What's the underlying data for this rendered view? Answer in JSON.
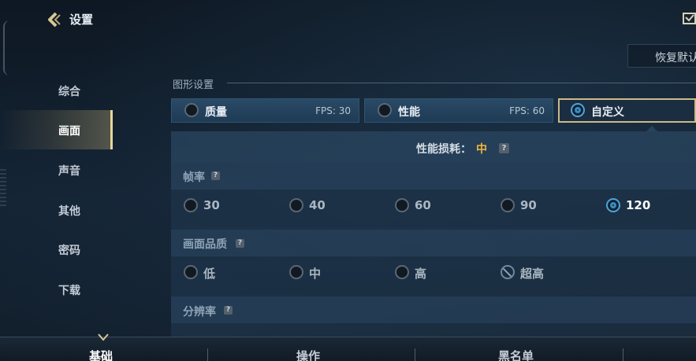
{
  "header": {
    "title": "设置",
    "restore_label": "恢复默认"
  },
  "sidebar": {
    "items": [
      {
        "label": "综合"
      },
      {
        "label": "画面",
        "active": true
      },
      {
        "label": "声音"
      },
      {
        "label": "其他"
      },
      {
        "label": "密码"
      },
      {
        "label": "下载"
      }
    ]
  },
  "graphics": {
    "section_title": "图形设置",
    "presets": [
      {
        "label": "质量",
        "fps": "FPS: 30"
      },
      {
        "label": "性能",
        "fps": "FPS: 60"
      },
      {
        "label": "自定义",
        "selected": true
      }
    ],
    "perf_label": "性能损耗：",
    "perf_value": "中",
    "help_glyph": "?",
    "framerate": {
      "title": "帧率",
      "options": [
        "30",
        "40",
        "60",
        "90",
        "120"
      ],
      "selected": "120"
    },
    "quality": {
      "title": "画面品质",
      "options": [
        "低",
        "中",
        "高",
        "超高"
      ],
      "disabled": "超高"
    },
    "resolution": {
      "title": "分辨率"
    }
  },
  "bottom_tabs": [
    {
      "label": "基础",
      "active": true
    },
    {
      "label": "操作"
    },
    {
      "label": "黑名单"
    }
  ],
  "colors": {
    "accent_gold": "#cdb98a",
    "accent_orange": "#f0b540",
    "radio_on": "#4ea3d6"
  }
}
